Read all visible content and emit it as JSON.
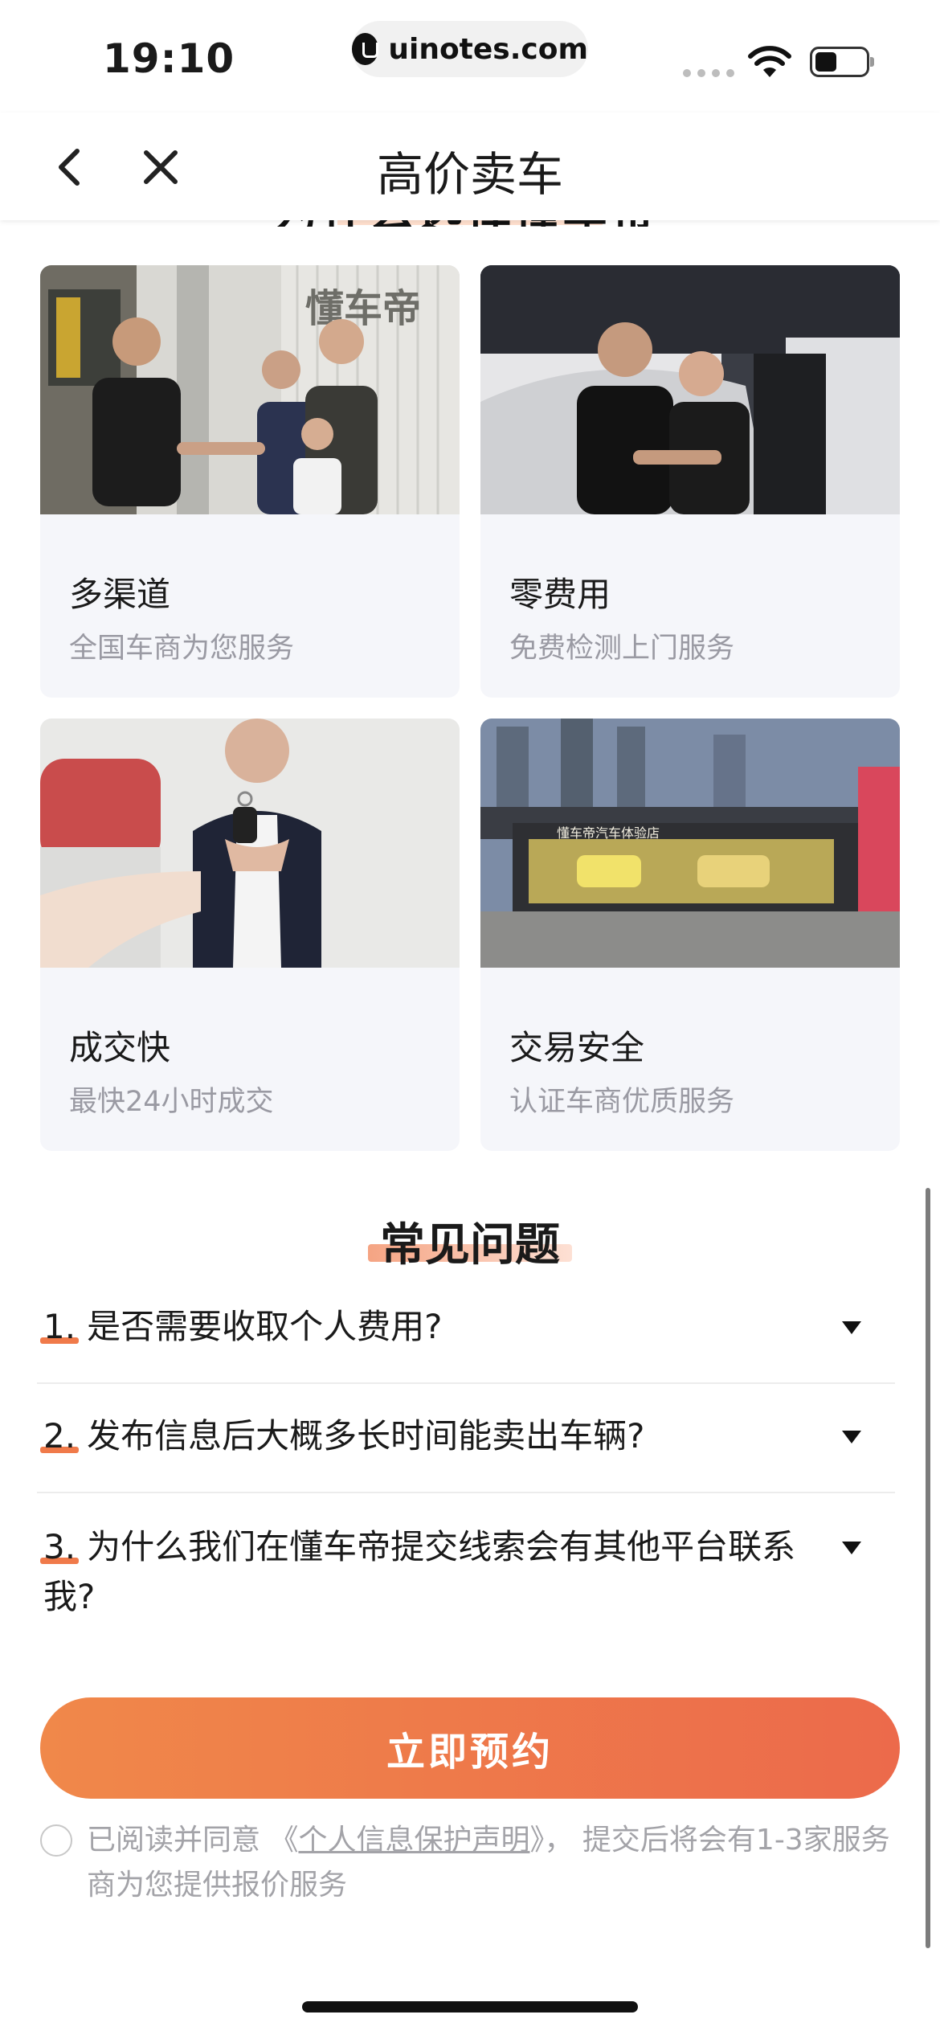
{
  "status_bar": {
    "time": "19:10",
    "url": "uinotes.com"
  },
  "nav": {
    "title": "高价卖车"
  },
  "features": [
    {
      "title": "多渠道",
      "subtitle": "全国车商为您服务"
    },
    {
      "title": "零费用",
      "subtitle": "免费检测上门服务"
    },
    {
      "title": "成交快",
      "subtitle": "最快24小时成交"
    },
    {
      "title": "交易安全",
      "subtitle": "认证车商优质服务"
    }
  ],
  "faq": {
    "title": "常见问题",
    "items": [
      {
        "num": "1.",
        "question": "是否需要收取个人费用?"
      },
      {
        "num": "2.",
        "question": "发布信息后大概多长时间能卖出车辆?"
      },
      {
        "num": "3.",
        "question": "为什么我们在懂车帝提交线索会有其他平台联系我?"
      }
    ]
  },
  "cta": {
    "label": "立即预约"
  },
  "agreement": {
    "prefix": "已阅读并同意 《",
    "link": "个人信息保护声明",
    "suffix": "》， 提交后将会有1-3家服务商为您提供报价服务"
  },
  "photo_labels": {
    "showroom_sign": "懂车帝",
    "store_sign": "懂车帝汽车体验店"
  },
  "colors": {
    "accent_start": "#f0884a",
    "accent_end": "#ec6a4b",
    "highlight": "#ffd7c2"
  }
}
